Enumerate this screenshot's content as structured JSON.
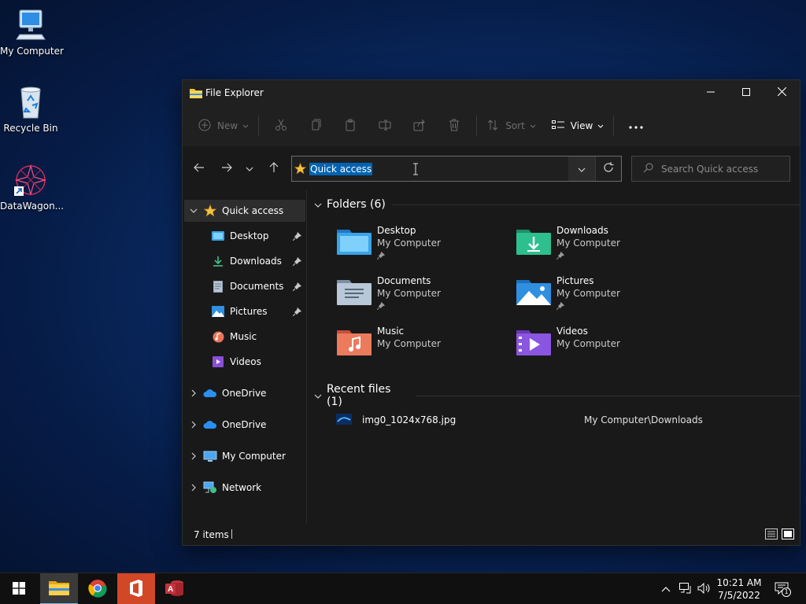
{
  "desktop": {
    "icons": [
      {
        "label": "My Computer"
      },
      {
        "label": "Recycle Bin"
      },
      {
        "label": "DataWagon..."
      }
    ]
  },
  "window": {
    "title": "File Explorer",
    "toolbar": {
      "new_label": "New",
      "sort_label": "Sort",
      "view_label": "View"
    },
    "address": {
      "value": "Quick access"
    },
    "search": {
      "placeholder": "Search Quick access"
    },
    "nav": {
      "quick_access": "Quick access",
      "pinned": [
        {
          "label": "Desktop"
        },
        {
          "label": "Downloads"
        },
        {
          "label": "Documents"
        },
        {
          "label": "Pictures"
        },
        {
          "label": "Music"
        },
        {
          "label": "Videos"
        }
      ],
      "roots": [
        {
          "label": "OneDrive"
        },
        {
          "label": "OneDrive"
        },
        {
          "label": "My Computer"
        },
        {
          "label": "Network"
        }
      ]
    },
    "folders_header": "Folders (6)",
    "folders": [
      {
        "name": "Desktop",
        "location": "My Computer"
      },
      {
        "name": "Downloads",
        "location": "My Computer"
      },
      {
        "name": "Documents",
        "location": "My Computer"
      },
      {
        "name": "Pictures",
        "location": "My Computer"
      },
      {
        "name": "Music",
        "location": "My Computer"
      },
      {
        "name": "Videos",
        "location": "My Computer"
      }
    ],
    "recent_header": "Recent files (1)",
    "recent": [
      {
        "name": "img0_1024x768.jpg",
        "path": "My Computer\\Downloads"
      }
    ],
    "status": "7 items"
  },
  "taskbar": {
    "time": "10:21 AM",
    "date": "7/5/2022",
    "notifications": "1"
  },
  "colors": {
    "accent": "#0063b1",
    "selection": "#2d2d2d",
    "window_bg": "#191919",
    "chrome_bg": "#202020"
  }
}
